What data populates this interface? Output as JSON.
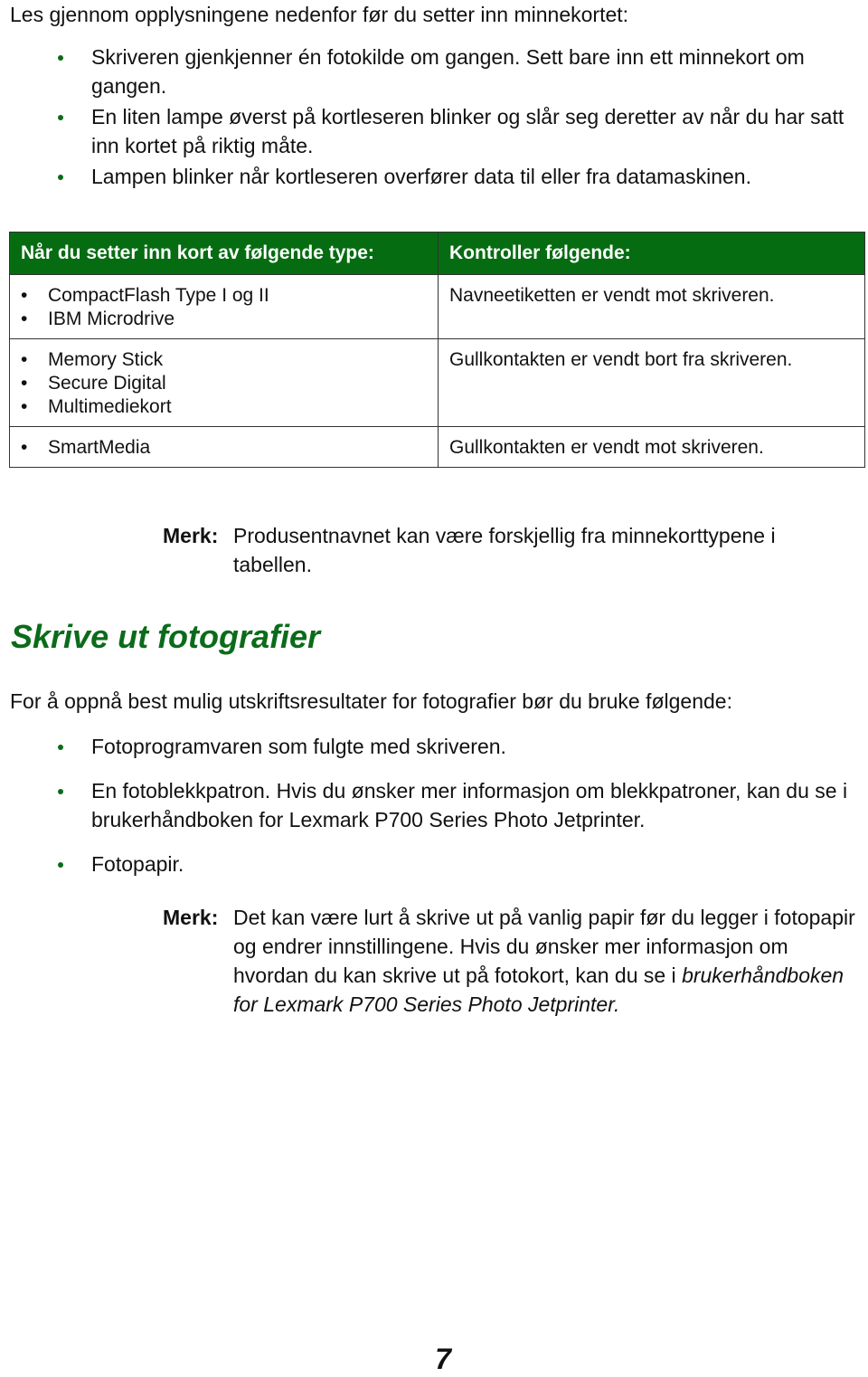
{
  "intro": "Les gjennom opplysningene nedenfor før du setter inn minnekortet:",
  "intro_bullets": [
    "Skriveren gjenkjenner én fotokilde om gangen. Sett bare inn ett minnekort om gangen.",
    "En liten lampe øverst på kortleseren blinker og slår seg deretter av når du har satt inn kortet på riktig måte.",
    "Lampen blinker når kortleseren overfører data til eller fra datamaskinen."
  ],
  "table": {
    "header_color": "#066c11",
    "headers": [
      "Når du setter inn kort av følgende type:",
      "Kontroller følgende:"
    ],
    "rows": [
      {
        "types": [
          "CompactFlash Type I og II",
          "IBM Microdrive"
        ],
        "check": "Navneetiketten er vendt mot skriveren."
      },
      {
        "types": [
          "Memory Stick",
          "Secure Digital",
          "Multimediekort"
        ],
        "check": "Gullkontakten er vendt bort fra skriveren."
      },
      {
        "types": [
          "SmartMedia"
        ],
        "check": "Gullkontakten er vendt mot skriveren."
      }
    ]
  },
  "note1": {
    "label": "Merk:",
    "text": "Produsentnavnet kan være forskjellig fra minnekorttypene i tabellen."
  },
  "section": {
    "heading": "Skrive ut fotografier",
    "heading_color": "#0b6b1a",
    "intro": "For å oppnå best mulig utskriftsresultater for fotografier bør du bruke følgende:",
    "bullets": [
      "Fotoprogramvaren som fulgte med skriveren.",
      "En fotoblekkpatron. Hvis du ønsker mer informasjon om blekkpatroner, kan du se i brukerhåndboken for Lexmark P700 Series Photo Jetprinter.",
      "Fotopapir."
    ]
  },
  "note2": {
    "label": "Merk:",
    "text_plain": "Det kan være lurt å skrive ut på vanlig papir før du legger i fotopapir og endrer innstillingene. Hvis du ønsker mer informasjon om hvordan du kan skrive ut på fotokort, kan du se i ",
    "text_italic": "brukerhåndboken for Lexmark P700 Series Photo Jetprinter."
  },
  "page_number": "7"
}
